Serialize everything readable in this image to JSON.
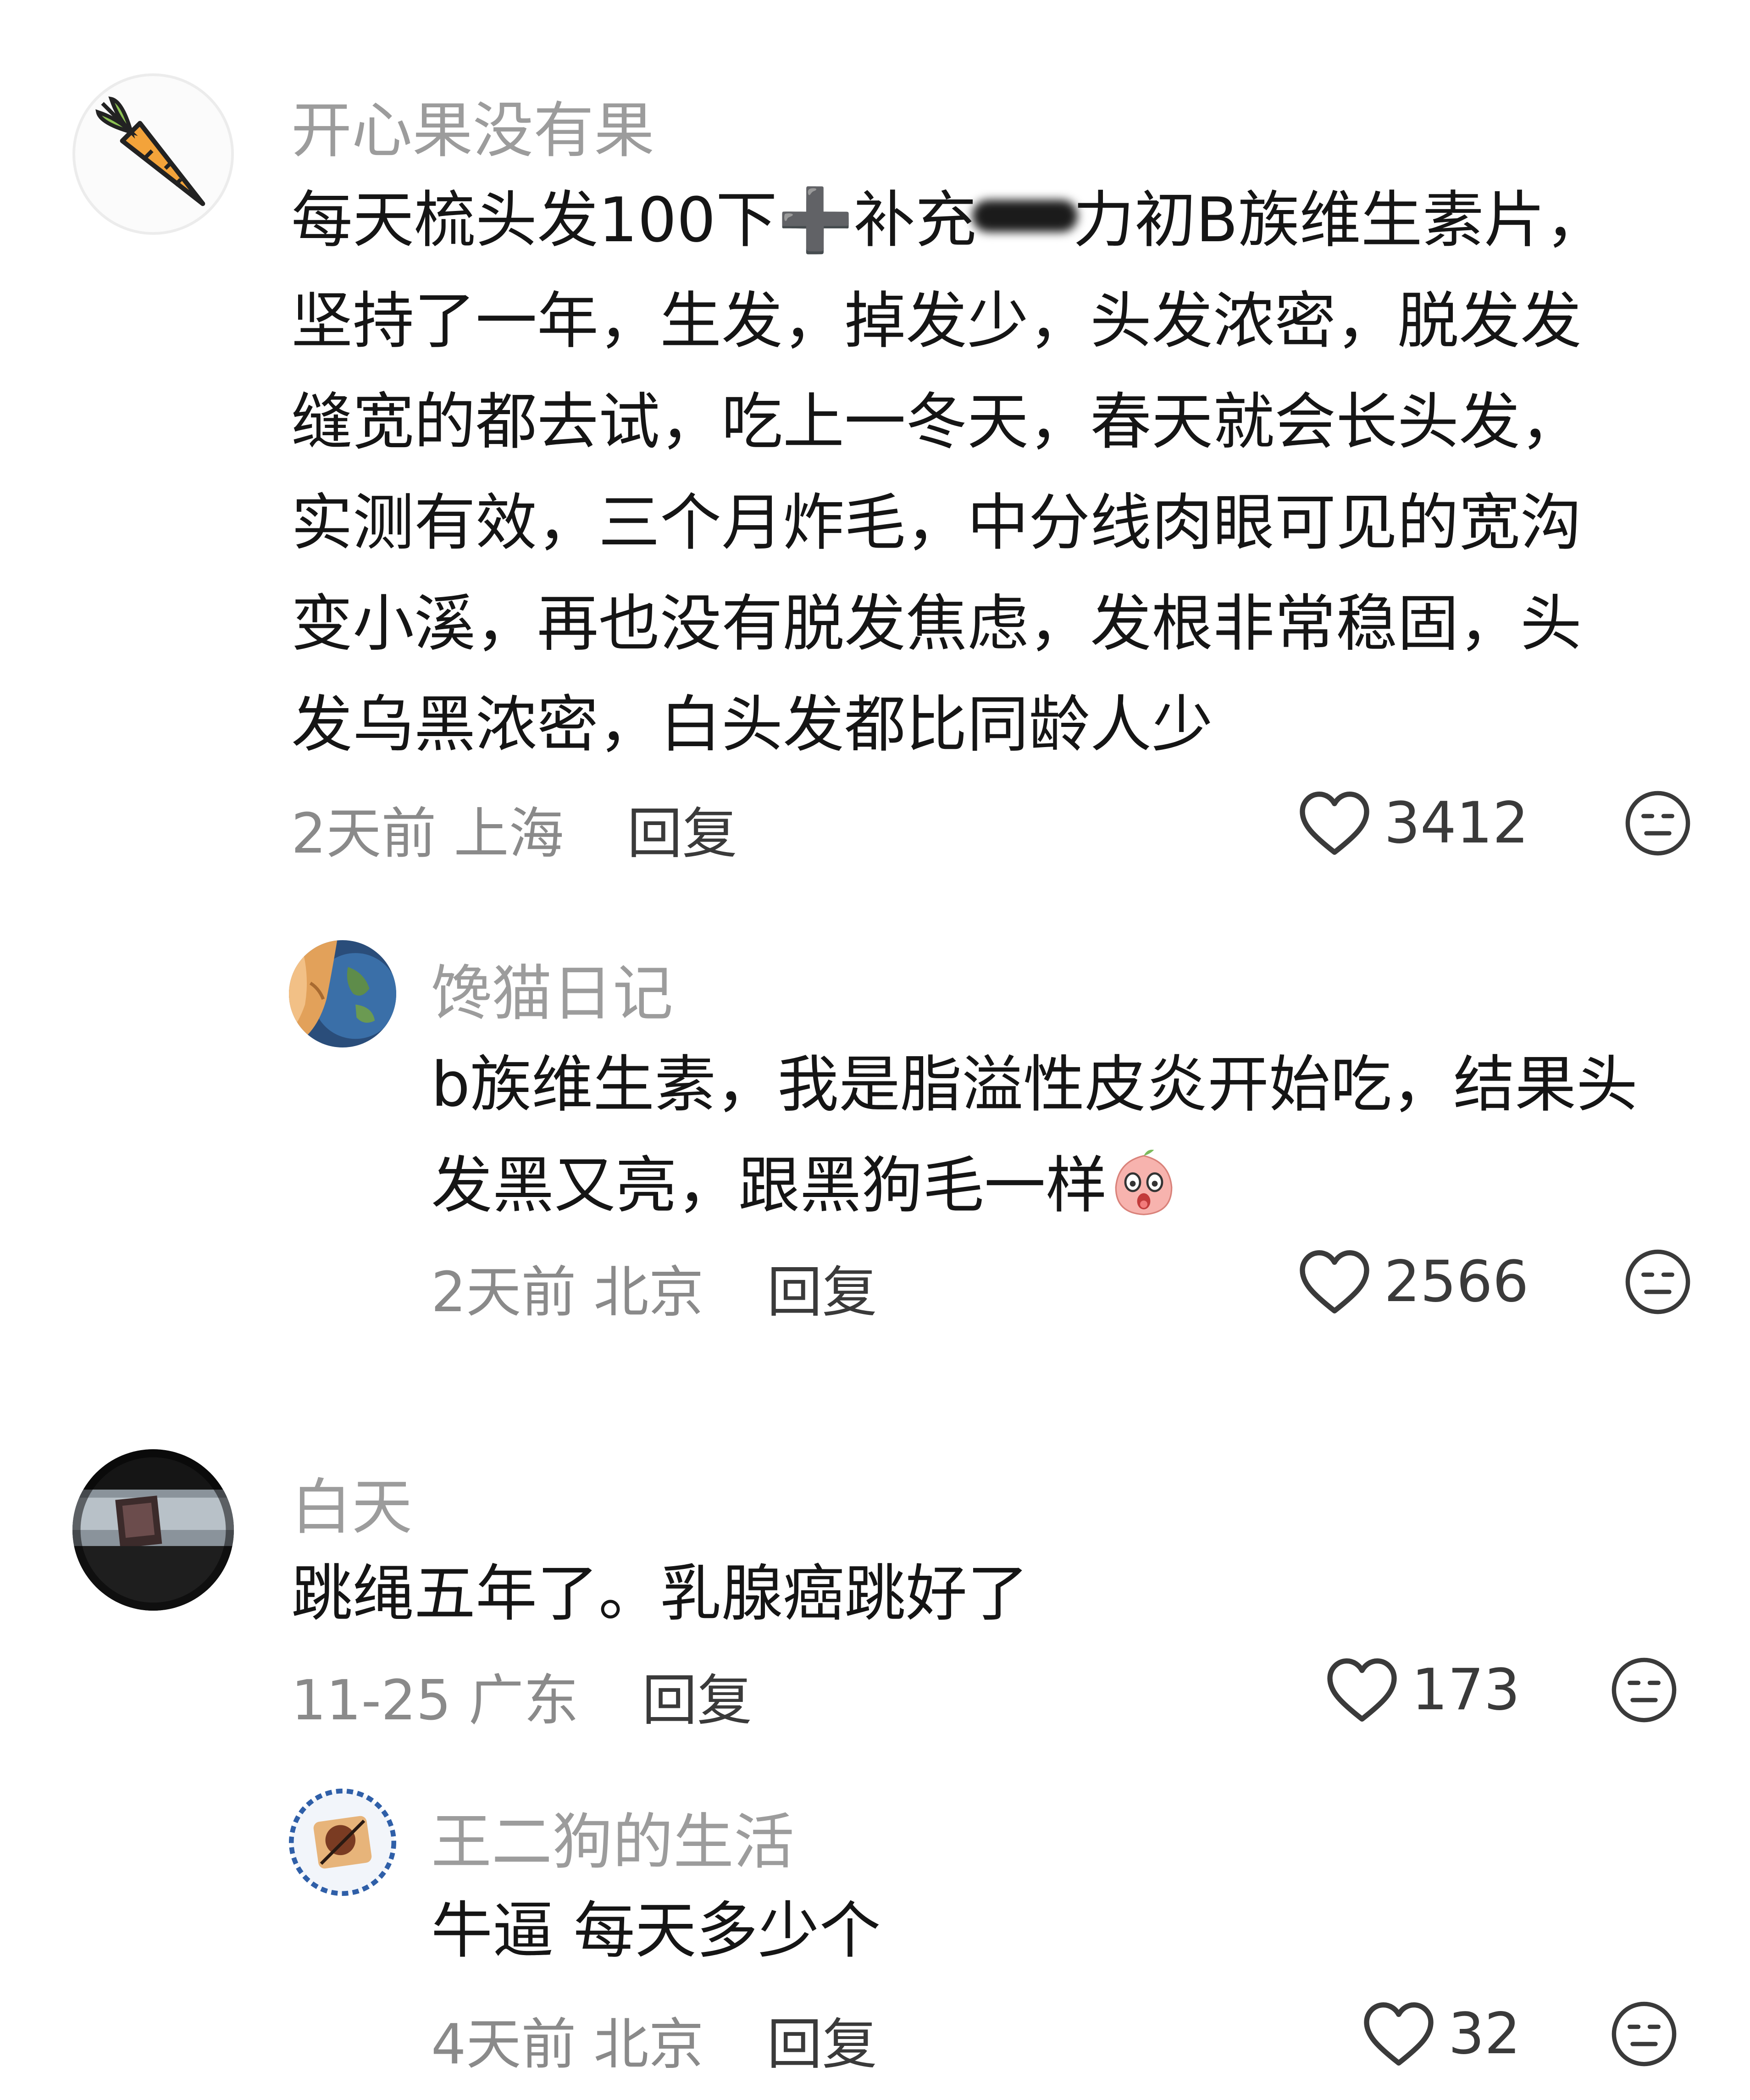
{
  "comments": [
    {
      "username": "开心果没有果",
      "avatar_icon": "carrot-icon",
      "lines": [
        [
          "每天梳头发100下",
          "➕",
          "补充",
          "力初B族维生素片，"
        ],
        "坚持了一年，生发，掉发少，头发浓密，脱发发",
        "缝宽的都去试，吃上一冬天，春天就会长头发，",
        "实测有效，三个月炸毛，中分线肉眼可见的宽沟",
        "变小溪，再也没有脱发焦虑，发根非常稳固，头",
        "发乌黑浓密，白头发都比同龄人少"
      ],
      "time_location": "2天前 上海",
      "reply_label": "回复",
      "likes": "3412",
      "replies": [
        {
          "username": "馋猫日记",
          "avatar_icon": "cat-earth-avatar",
          "lines": [
            "b族维生素，我是脂溢性皮炎开始吃，结果头",
            "发黑又亮，跟黑狗毛一样"
          ],
          "emoji": "shocked-peach-emoji",
          "time_location": "2天前 北京",
          "reply_label": "回复",
          "likes": "2566"
        }
      ]
    },
    {
      "username": "白天",
      "avatar_icon": "dark-photo-avatar",
      "lines": [
        "跳绳五年了。乳腺癌跳好了"
      ],
      "time_location": "11-25 广东",
      "reply_label": "回复",
      "likes": "173",
      "replies": [
        {
          "username": "王二狗的生活",
          "avatar_icon": "food-plate-avatar",
          "lines": [
            "牛逼 每天多少个"
          ],
          "time_location": "4天前 北京",
          "reply_label": "回复",
          "likes": "32"
        }
      ]
    }
  ],
  "colors": {
    "username": "#9c9c9c",
    "body": "#151515",
    "meta": "#8a8a8a",
    "icon": "#3a3a3a"
  }
}
